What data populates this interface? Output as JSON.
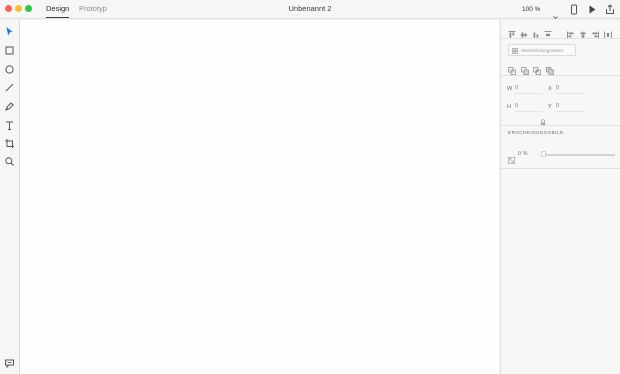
{
  "titlebar": {
    "tabs": [
      {
        "label": "Design",
        "active": true
      },
      {
        "label": "Prototyp",
        "active": false
      }
    ],
    "document_title": "Unbenannt 2",
    "zoom": "100 %",
    "icons": [
      "chevron-down-icon",
      "device-preview-icon",
      "play-icon",
      "share-icon"
    ]
  },
  "tools": [
    "select-icon",
    "rectangle-icon",
    "ellipse-icon",
    "line-icon",
    "pen-icon",
    "text-icon",
    "artboard-icon",
    "zoom-icon",
    "comments-icon"
  ],
  "panel": {
    "align_icons": [
      "align-top-icon",
      "align-middle-icon",
      "align-bottom-icon",
      "distribute-vertical-icon",
      "align-left-icon",
      "align-center-icon",
      "align-right-icon",
      "distribute-horizontal-icon"
    ],
    "repeat_grid_label": "Wiederholungsraster",
    "boolean_icons": [
      "boolean-add-icon",
      "boolean-subtract-icon",
      "boolean-intersect-icon",
      "boolean-exclude-icon"
    ],
    "transform": {
      "w_label": "W",
      "w_value": "0",
      "x_label": "X",
      "x_value": "0",
      "h_label": "H",
      "h_value": "0",
      "y_label": "Y",
      "y_value": "0"
    },
    "appearance_title": "ERSCHEINUNGSBILD",
    "opacity": "0 %",
    "opacity_level": 0
  },
  "colors": {
    "accent": "#1473e6",
    "close": "#fe5f57",
    "minimize": "#febc2e",
    "maximize": "#28c840"
  }
}
